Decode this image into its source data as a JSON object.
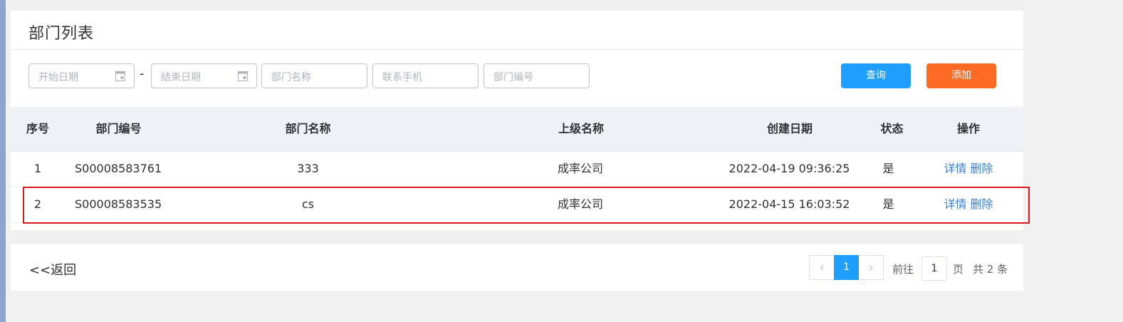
{
  "page": {
    "title": "部门列表"
  },
  "filters": {
    "start_date_placeholder": "开始日期",
    "separator": "-",
    "end_date_placeholder": "结束日期",
    "dept_name_placeholder": "部门名称",
    "phone_placeholder": "联系手机",
    "dept_code_placeholder": "部门编号"
  },
  "buttons": {
    "query": "查询",
    "add": "添加"
  },
  "table": {
    "headers": {
      "index": "序号",
      "code": "部门编号",
      "name": "部门名称",
      "parent": "上级名称",
      "created": "创建日期",
      "status": "状态",
      "actions": "操作"
    },
    "rows": [
      {
        "index": "1",
        "code": "S00008583761",
        "name": "333",
        "parent": "成率公司",
        "created": "2022-04-19 09:36:25",
        "status": "是",
        "detail": "详情",
        "delete": "删除"
      },
      {
        "index": "2",
        "code": "S00008583535",
        "name": "cs",
        "parent": "成率公司",
        "created": "2022-04-15 16:03:52",
        "status": "是",
        "detail": "详情",
        "delete": "删除"
      }
    ]
  },
  "footer": {
    "back": "<<返回",
    "current_page": "1",
    "goto_label": "前往",
    "goto_value": "1",
    "page_unit": "页",
    "total": "共 2 条"
  },
  "colors": {
    "primary": "#1e9fff",
    "add": "#ff6a24",
    "link": "#3a7fd6",
    "highlight": "#d9191f"
  },
  "icons": {
    "date": "calendar-icon",
    "prev": "chevron-left-icon",
    "next": "chevron-right-icon"
  }
}
